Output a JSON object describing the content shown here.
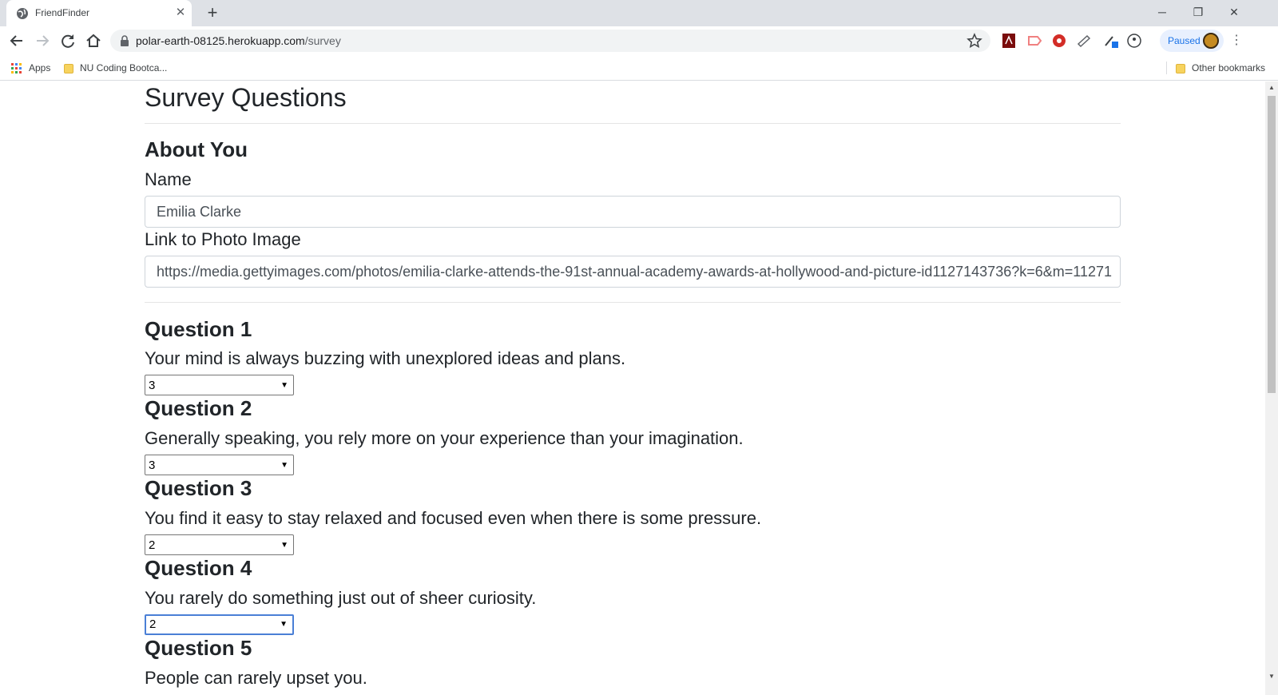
{
  "browser": {
    "tab_title": "FriendFinder",
    "url_host": "polar-earth-08125.herokuapp.com",
    "url_path": "/survey",
    "profile_label": "Paused",
    "bookmarks": {
      "apps": "Apps",
      "item1": "NU Coding Bootca...",
      "other": "Other bookmarks"
    }
  },
  "page": {
    "title": "Survey Questions",
    "about_heading": "About You",
    "name_label": "Name",
    "name_value": "Emilia Clarke",
    "photo_label": "Link to Photo Image",
    "photo_value": "https://media.gettyimages.com/photos/emilia-clarke-attends-the-91st-annual-academy-awards-at-hollywood-and-picture-id1127143736?k=6&m=11271"
  },
  "questions": [
    {
      "title": "Question 1",
      "text": "Your mind is always buzzing with unexplored ideas and plans.",
      "value": "3"
    },
    {
      "title": "Question 2",
      "text": "Generally speaking, you rely more on your experience than your imagination.",
      "value": "3"
    },
    {
      "title": "Question 3",
      "text": "You find it easy to stay relaxed and focused even when there is some pressure.",
      "value": "2"
    },
    {
      "title": "Question 4",
      "text": "You rarely do something just out of sheer curiosity.",
      "value": "2"
    },
    {
      "title": "Question 5",
      "text": "People can rarely upset you."
    }
  ]
}
